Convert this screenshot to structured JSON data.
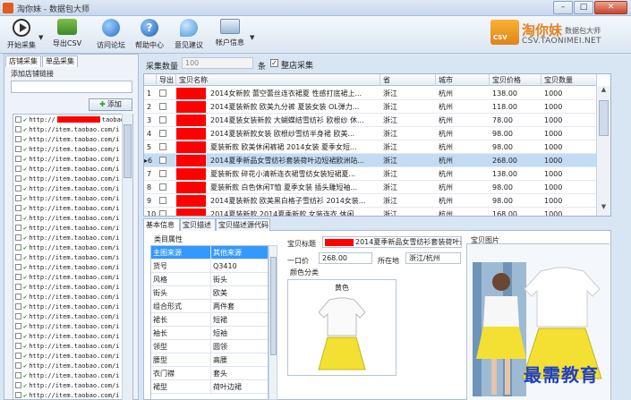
{
  "window": {
    "title": "淘你妹 - 数据包大师"
  },
  "toolbar": {
    "items": [
      {
        "label": "开始采集",
        "icon": "play-icon"
      },
      {
        "label": "导出CSV",
        "icon": "export-csv-icon"
      },
      {
        "label": "访问论坛",
        "icon": "globe-icon"
      },
      {
        "label": "帮助中心",
        "icon": "help-icon"
      },
      {
        "label": "意见建议",
        "icon": "chat-bubble-icon"
      },
      {
        "label": "帐户信息",
        "icon": "id-card-icon"
      }
    ]
  },
  "brand": {
    "name": "淘你妹",
    "sub": "数据包大师",
    "url": "CSV.TAONIMEI.NET",
    "badge": "CSV"
  },
  "left": {
    "tabs": [
      "店铺采集",
      "单品采集"
    ],
    "add_label": "添加店铺链接",
    "add_button": "添加",
    "links": [
      "http://",
      "http://item.taobao.com/i",
      "http://item.taobao.com/i",
      "http://item.taobao.com/i",
      "http://item.taobao.com/i",
      "http://item.taobao.com/i",
      "http://item.taobao.com/i",
      "http://item.taobao.com/i",
      "http://item.taobao.com/i",
      "http://item.taobao.com/i",
      "http://item.taobao.com/i",
      "http://item.taobao.com/i",
      "http://item.taobao.com/i",
      "http://item.taobao.com/i",
      "http://item.taobao.com/i",
      "http://item.taobao.com/i",
      "http://item.taobao.com/i",
      "http://item.taobao.com/i",
      "http://item.taobao.com/i",
      "http://item.taobao.com/i",
      "http://item.taobao.com/i",
      "http://item.taobao.com/i",
      "http://item.taobao.com/i",
      "http://item.taobao.com/i",
      "http://item.taobao.com/i",
      "http://item.taobao.com/i",
      "http://item.taobao.com/i",
      "http://item.taobao.com/i",
      "http://item.taobao.com/i"
    ],
    "first_link_suffix": "taobao.c"
  },
  "collect": {
    "count_label": "采集数量",
    "count_value": "100",
    "count_unit": "条",
    "whole_shop_label": "整店采集",
    "whole_shop_checked": true
  },
  "grid": {
    "headers": [
      "",
      "导出",
      "宝贝名称",
      "省",
      "城市",
      "宝贝价格",
      "宝贝数量"
    ],
    "rows": [
      {
        "n": "1",
        "name": "2014女新款 蕾空蕾丝连衣裙夏 性感打底裙上...",
        "prov": "浙江",
        "city": "杭州",
        "price": "138.00",
        "qty": "1000"
      },
      {
        "n": "2",
        "name": "2014夏装新款 欧美九分裤 夏装女装 OL弹力...",
        "prov": "浙江",
        "city": "杭州",
        "price": "118.00",
        "qty": "1000"
      },
      {
        "n": "3",
        "name": "2014夏装女装新款 大蝴蝶结雪纺衫 欧根纱 休...",
        "prov": "浙江",
        "city": "杭州",
        "price": "78.00",
        "qty": "1000"
      },
      {
        "n": "4",
        "name": "2014夏装新款女装 欧根纱雪纺半身裙  欧美...",
        "prov": "浙江",
        "city": "杭州",
        "price": "98.00",
        "qty": "1000"
      },
      {
        "n": "5",
        "name": "夏装新款 欧美休闲裤裙 2014女装 夏季女短...",
        "prov": "浙江",
        "city": "杭州",
        "price": "98.00",
        "qty": "1000"
      },
      {
        "n": "6",
        "name": "2014夏季新品女雪纺衫套装荷叶边短裙欧洲站...",
        "prov": "浙江",
        "city": "杭州",
        "price": "268.00",
        "qty": "1000",
        "selected": true
      },
      {
        "n": "7",
        "name": "夏装新款 碎花小清新连衣裙雪纺女装短裙夏...",
        "prov": "浙江",
        "city": "杭州",
        "price": "138.00",
        "qty": "1000"
      },
      {
        "n": "8",
        "name": "夏装新款 白色休闲T恤 夏季女装 插头雕短袖...",
        "prov": "浙江",
        "city": "杭州",
        "price": "98.00",
        "qty": "1000"
      },
      {
        "n": "9",
        "name": "2014夏装新款 欧美黑白格子雪纺衫 2014女装...",
        "prov": "浙江",
        "city": "杭州",
        "price": "98.00",
        "qty": "1000"
      },
      {
        "n": "10",
        "name": "2014夏装新款 2014夏季新款 女装连衣 休闲...",
        "prov": "浙江",
        "city": "杭州",
        "price": "168.00",
        "qty": "1000"
      }
    ]
  },
  "detail": {
    "tabs": [
      "基本信息",
      "宝贝描述",
      "宝贝描述源代码"
    ],
    "category_label": "类目属性",
    "attrs": [
      {
        "k": "主图来源",
        "v": "其他来源",
        "selected": true
      },
      {
        "k": "货号",
        "v": "Q3410"
      },
      {
        "k": "风格",
        "v": "街头"
      },
      {
        "k": "街头",
        "v": "欧美"
      },
      {
        "k": "组合形式",
        "v": "两件套"
      },
      {
        "k": "裙长",
        "v": "短裙"
      },
      {
        "k": "袖长",
        "v": "短袖"
      },
      {
        "k": "领型",
        "v": "圆领"
      },
      {
        "k": "腰型",
        "v": "高腰"
      },
      {
        "k": "衣门襟",
        "v": "套头"
      },
      {
        "k": "裙型",
        "v": "荷叶边裙"
      }
    ],
    "title_label": "宝贝标题",
    "title_value": "2014夏季新品女雪纺衫套装荷叶边",
    "price_label": "一口价",
    "price_value": "268.00",
    "location_label": "所在地",
    "location_value": "浙江/杭州",
    "color_label": "颜色分类",
    "color_value": "黄色",
    "pic_label": "宝贝图片"
  },
  "watermark": "最需教育",
  "colors": {
    "accent": "#e5821c",
    "selection": "#c3dcf5",
    "redacted": "#ff0000",
    "watermark": "#1e3fc7"
  }
}
